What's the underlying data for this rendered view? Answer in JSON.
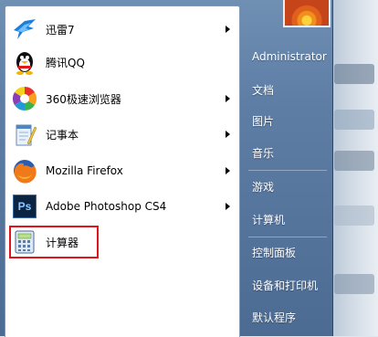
{
  "programs": [
    {
      "label": "迅雷7",
      "icon": "thunder-bird-icon",
      "has_submenu": true
    },
    {
      "label": "腾讯QQ",
      "icon": "qq-penguin-icon",
      "has_submenu": false
    },
    {
      "label": "360极速浏览器",
      "icon": "360-browser-icon",
      "has_submenu": true
    },
    {
      "label": "记事本",
      "icon": "notepad-icon",
      "has_submenu": true
    },
    {
      "label": "Mozilla Firefox",
      "icon": "firefox-icon",
      "has_submenu": true
    },
    {
      "label": "Adobe Photoshop CS4",
      "icon": "photoshop-icon",
      "icon_text": "Ps",
      "has_submenu": true
    },
    {
      "label": "计算器",
      "icon": "calculator-icon",
      "has_submenu": false,
      "highlighted": true
    }
  ],
  "right_pane": {
    "username": "Administrator",
    "items": [
      "文档",
      "图片",
      "音乐",
      "游戏",
      "计算机",
      "控制面板",
      "设备和打印机",
      "默认程序"
    ]
  },
  "colors": {
    "highlight_border": "#e0141b",
    "frame_blue": "#5e7ea6"
  }
}
